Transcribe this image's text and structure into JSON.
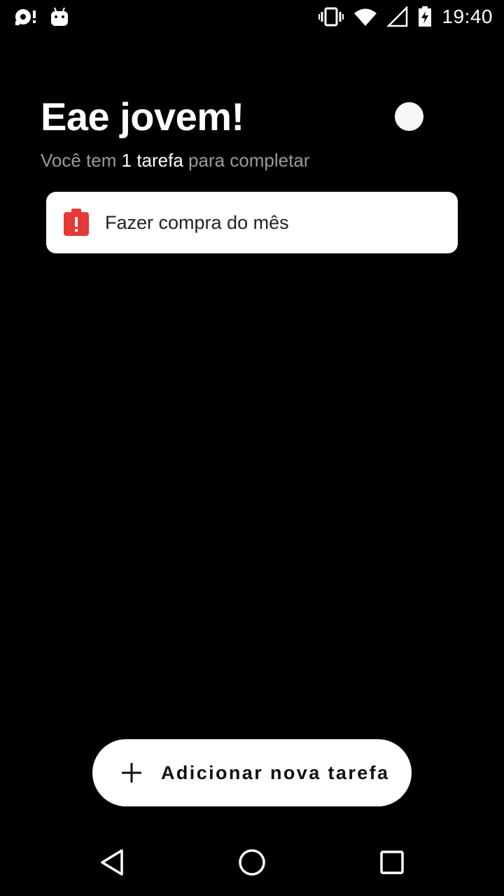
{
  "status_bar": {
    "time": "19:40",
    "icons": [
      "notification-icon",
      "android-icon",
      "vibrate-icon",
      "wifi-icon",
      "signal-icon",
      "battery-charging-icon"
    ]
  },
  "header": {
    "greeting": "Eae jovem!",
    "subtitle_prefix": "Você tem",
    "subtitle_count": "1 tarefa",
    "subtitle_suffix": "para completar"
  },
  "tasks": [
    {
      "title": "Fazer compra do mês",
      "icon": "clipboard-alert-icon",
      "icon_color": "#e53935"
    }
  ],
  "add_button": {
    "label": "Adicionar nova tarefa",
    "icon": "plus-icon"
  },
  "navigation": {
    "buttons": [
      "back-icon",
      "home-icon",
      "recents-icon"
    ]
  },
  "colors": {
    "background": "#000000",
    "card": "#ffffff",
    "alert": "#e53935",
    "muted_text": "#9a9a9a"
  }
}
